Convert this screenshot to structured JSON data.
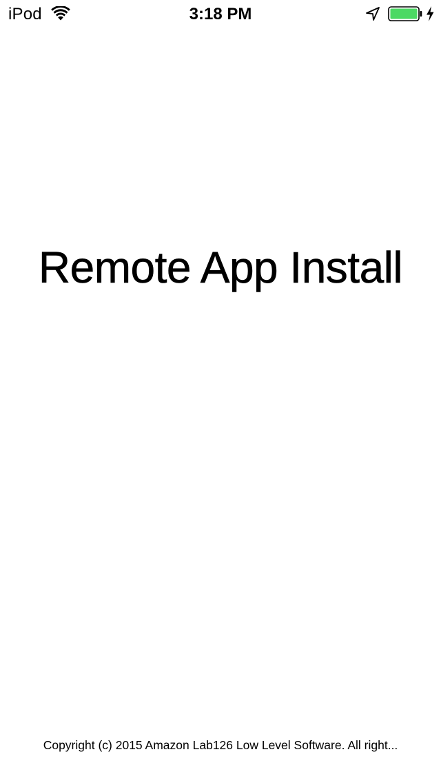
{
  "status_bar": {
    "carrier": "iPod",
    "time": "3:18 PM",
    "icons": [
      "wifi-icon",
      "location-arrow-icon",
      "battery-icon",
      "charging-bolt-icon"
    ],
    "battery_color": "#4cd964"
  },
  "main": {
    "title": "Remote App Install"
  },
  "footer": {
    "copyright": "Copyright (c) 2015 Amazon Lab126 Low Level Software. All right..."
  }
}
